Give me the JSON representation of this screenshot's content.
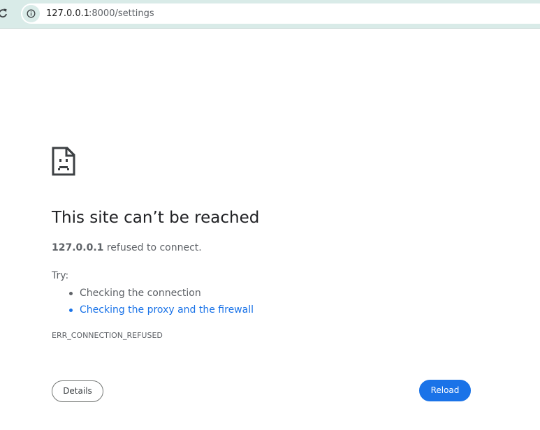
{
  "browser": {
    "url_host": "127.0.0.1",
    "url_path": ":8000/settings"
  },
  "error": {
    "title": "This site can’t be reached",
    "host": "127.0.0.1",
    "message": " refused to connect.",
    "try_label": "Try:",
    "suggestions": [
      {
        "text": "Checking the connection",
        "link": false
      },
      {
        "text": "Checking the proxy and the firewall",
        "link": true
      }
    ],
    "code": "ERR_CONNECTION_REFUSED"
  },
  "buttons": {
    "details": "Details",
    "reload": "Reload"
  },
  "icons": {
    "reload": "reload-icon",
    "site_info": "info-icon",
    "error": "sad-page-icon"
  },
  "colors": {
    "toolbar_bg": "#d9ebe8",
    "link": "#1a73e8",
    "primary_button": "#1a73e8",
    "text_secondary": "#5f6368"
  }
}
